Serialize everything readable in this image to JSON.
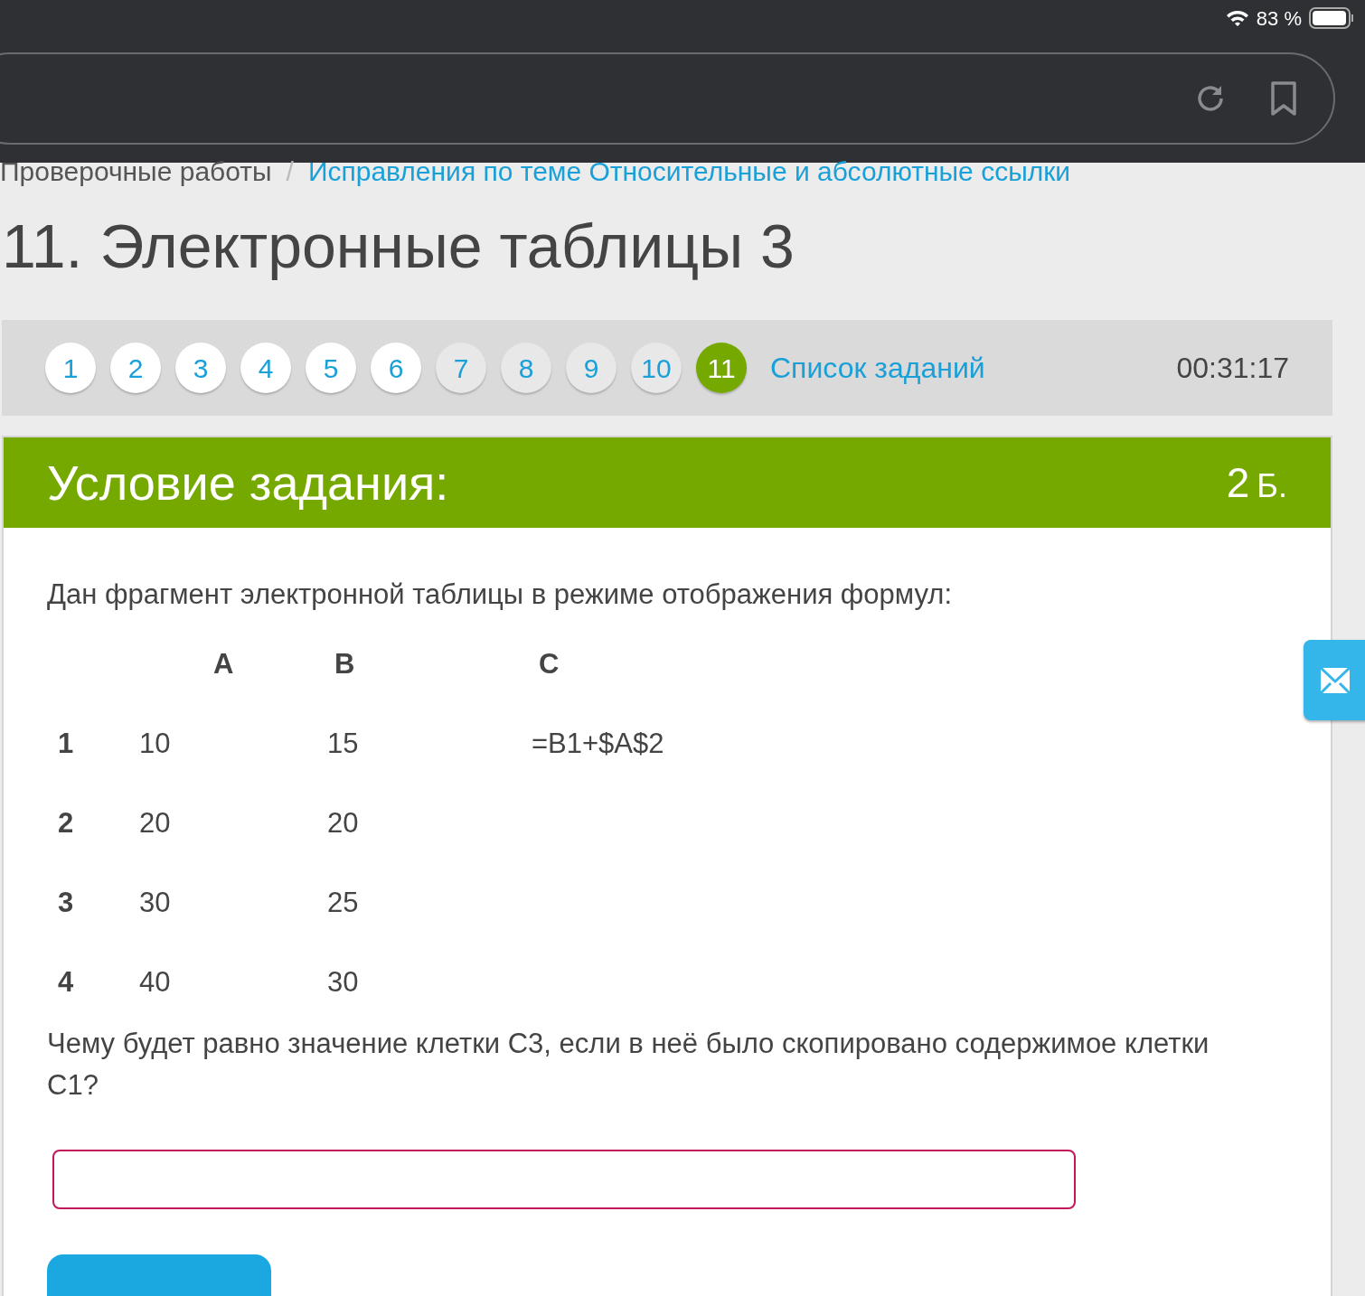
{
  "status_bar": {
    "battery": "83 %"
  },
  "breadcrumb": [
    {
      "label": "Проверочные работы",
      "link": false
    },
    {
      "label": "/",
      "link": false
    },
    {
      "label": "Исправления по теме Относительные и абсолютные ссылки",
      "link": true
    }
  ],
  "title": "11. Электронные таблицы 3",
  "task_nav": {
    "items": [
      {
        "label": "1",
        "answered": true,
        "selected": false
      },
      {
        "label": "2",
        "answered": true,
        "selected": false
      },
      {
        "label": "3",
        "answered": true,
        "selected": false
      },
      {
        "label": "4",
        "answered": true,
        "selected": false
      },
      {
        "label": "5",
        "answered": true,
        "selected": false
      },
      {
        "label": "6",
        "answered": true,
        "selected": false
      },
      {
        "label": "7",
        "answered": false,
        "selected": false
      },
      {
        "label": "8",
        "answered": false,
        "selected": false
      },
      {
        "label": "9",
        "answered": false,
        "selected": false
      },
      {
        "label": "10",
        "answered": false,
        "selected": false
      },
      {
        "label": "11",
        "answered": false,
        "selected": true
      }
    ],
    "list_link": "Список заданий",
    "timer": "00:31:17"
  },
  "task": {
    "heading": "Условие задания:",
    "points": "2",
    "points_unit": "Б.",
    "intro": "Дан фрагмент электронной таблицы в режиме отображения формул:",
    "table": {
      "columns": [
        "",
        "A",
        "B",
        "C"
      ],
      "rows": [
        [
          "1",
          "10",
          "15",
          "=B1+$A$2"
        ],
        [
          "2",
          "20",
          "20",
          ""
        ],
        [
          "3",
          "30",
          "25",
          ""
        ],
        [
          "4",
          "40",
          "30",
          ""
        ]
      ]
    },
    "question": "Чему будет равно значение клетки C3, если в неё было скопировано содержимое клетки C1?"
  }
}
